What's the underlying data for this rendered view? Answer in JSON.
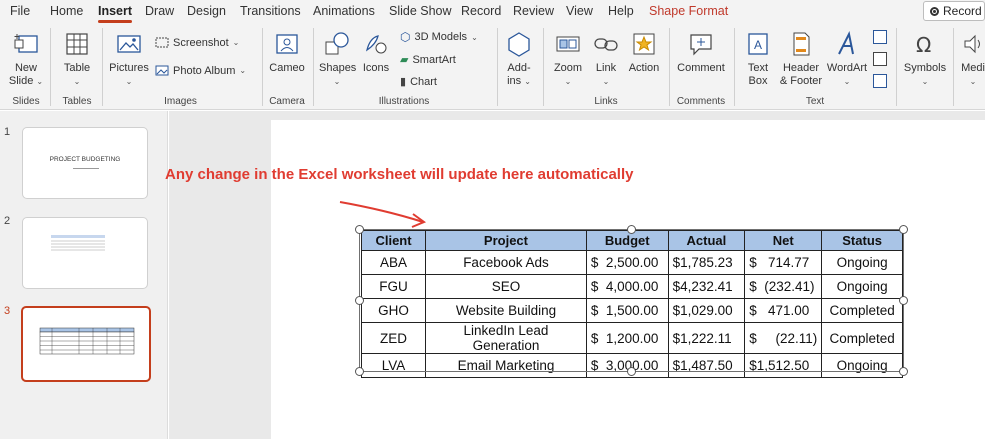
{
  "menu": {
    "tabs": [
      "File",
      "Home",
      "Insert",
      "Draw",
      "Design",
      "Transitions",
      "Animations",
      "Slide Show",
      "Record",
      "Review",
      "View",
      "Help",
      "Shape Format"
    ],
    "active_tab": "Insert",
    "record_button": "Record"
  },
  "ribbon": {
    "slides": {
      "new_slide_1": "New",
      "new_slide_2": "Slide",
      "group": "Slides"
    },
    "tables": {
      "table": "Table",
      "group": "Tables"
    },
    "images": {
      "pictures": "Pictures",
      "screenshot": "Screenshot",
      "photo_album": "Photo Album",
      "group": "Images"
    },
    "camera": {
      "cameo": "Cameo",
      "group": "Camera"
    },
    "illustrations": {
      "shapes": "Shapes",
      "icons": "Icons",
      "models_3d": "3D Models",
      "smartart": "SmartArt",
      "chart": "Chart",
      "group": "Illustrations"
    },
    "addins": {
      "label_1": "Add-",
      "label_2": "ins"
    },
    "links": {
      "zoom": "Zoom",
      "link": "Link",
      "action": "Action",
      "group": "Links"
    },
    "comments": {
      "comment": "Comment",
      "group": "Comments"
    },
    "text": {
      "text_box_1": "Text",
      "text_box_2": "Box",
      "header_1": "Header",
      "header_2": "& Footer",
      "wordart": "WordArt",
      "group": "Text"
    },
    "symbols": {
      "symbols": "Symbols"
    },
    "media": {
      "media": "Medi"
    }
  },
  "thumbnails": [
    {
      "number": "1",
      "title": "PROJECT BUDGETING"
    },
    {
      "number": "2"
    },
    {
      "number": "3"
    }
  ],
  "annotation": "Any change in the Excel worksheet will update here automatically",
  "table": {
    "headers": [
      "Client",
      "Project",
      "Budget",
      "Actual",
      "Net",
      "Status"
    ],
    "rows": [
      [
        "ABA",
        "Facebook Ads",
        "$  2,500.00",
        "$1,785.23",
        "$   714.77",
        "Ongoing"
      ],
      [
        "FGU",
        "SEO",
        "$  4,000.00",
        "$4,232.41",
        "$  (232.41)",
        "Ongoing"
      ],
      [
        "GHO",
        "Website Building",
        "$  1,500.00",
        "$1,029.00",
        "$   471.00",
        "Completed"
      ],
      [
        "ZED",
        "LinkedIn Lead Generation",
        "$  1,200.00",
        "$1,222.11",
        "$     (22.11)",
        "Completed"
      ],
      [
        "LVA",
        "Email Marketing",
        "$  3,000.00",
        "$1,487.50",
        "$1,512.50",
        "Ongoing"
      ]
    ]
  },
  "colors": {
    "accent": "#c43e1c",
    "annotation": "#e03c31",
    "header_fill": "#a9c4e6"
  }
}
